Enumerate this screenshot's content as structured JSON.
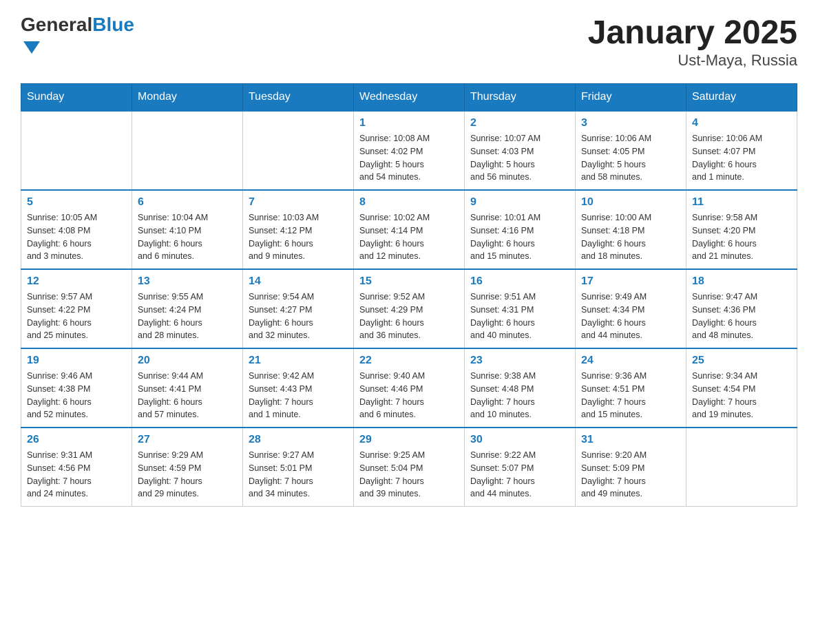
{
  "logo": {
    "text_general": "General",
    "text_blue": "Blue"
  },
  "title": "January 2025",
  "location": "Ust-Maya, Russia",
  "days_of_week": [
    "Sunday",
    "Monday",
    "Tuesday",
    "Wednesday",
    "Thursday",
    "Friday",
    "Saturday"
  ],
  "weeks": [
    [
      {
        "day": "",
        "info": ""
      },
      {
        "day": "",
        "info": ""
      },
      {
        "day": "",
        "info": ""
      },
      {
        "day": "1",
        "info": "Sunrise: 10:08 AM\nSunset: 4:02 PM\nDaylight: 5 hours\nand 54 minutes."
      },
      {
        "day": "2",
        "info": "Sunrise: 10:07 AM\nSunset: 4:03 PM\nDaylight: 5 hours\nand 56 minutes."
      },
      {
        "day": "3",
        "info": "Sunrise: 10:06 AM\nSunset: 4:05 PM\nDaylight: 5 hours\nand 58 minutes."
      },
      {
        "day": "4",
        "info": "Sunrise: 10:06 AM\nSunset: 4:07 PM\nDaylight: 6 hours\nand 1 minute."
      }
    ],
    [
      {
        "day": "5",
        "info": "Sunrise: 10:05 AM\nSunset: 4:08 PM\nDaylight: 6 hours\nand 3 minutes."
      },
      {
        "day": "6",
        "info": "Sunrise: 10:04 AM\nSunset: 4:10 PM\nDaylight: 6 hours\nand 6 minutes."
      },
      {
        "day": "7",
        "info": "Sunrise: 10:03 AM\nSunset: 4:12 PM\nDaylight: 6 hours\nand 9 minutes."
      },
      {
        "day": "8",
        "info": "Sunrise: 10:02 AM\nSunset: 4:14 PM\nDaylight: 6 hours\nand 12 minutes."
      },
      {
        "day": "9",
        "info": "Sunrise: 10:01 AM\nSunset: 4:16 PM\nDaylight: 6 hours\nand 15 minutes."
      },
      {
        "day": "10",
        "info": "Sunrise: 10:00 AM\nSunset: 4:18 PM\nDaylight: 6 hours\nand 18 minutes."
      },
      {
        "day": "11",
        "info": "Sunrise: 9:58 AM\nSunset: 4:20 PM\nDaylight: 6 hours\nand 21 minutes."
      }
    ],
    [
      {
        "day": "12",
        "info": "Sunrise: 9:57 AM\nSunset: 4:22 PM\nDaylight: 6 hours\nand 25 minutes."
      },
      {
        "day": "13",
        "info": "Sunrise: 9:55 AM\nSunset: 4:24 PM\nDaylight: 6 hours\nand 28 minutes."
      },
      {
        "day": "14",
        "info": "Sunrise: 9:54 AM\nSunset: 4:27 PM\nDaylight: 6 hours\nand 32 minutes."
      },
      {
        "day": "15",
        "info": "Sunrise: 9:52 AM\nSunset: 4:29 PM\nDaylight: 6 hours\nand 36 minutes."
      },
      {
        "day": "16",
        "info": "Sunrise: 9:51 AM\nSunset: 4:31 PM\nDaylight: 6 hours\nand 40 minutes."
      },
      {
        "day": "17",
        "info": "Sunrise: 9:49 AM\nSunset: 4:34 PM\nDaylight: 6 hours\nand 44 minutes."
      },
      {
        "day": "18",
        "info": "Sunrise: 9:47 AM\nSunset: 4:36 PM\nDaylight: 6 hours\nand 48 minutes."
      }
    ],
    [
      {
        "day": "19",
        "info": "Sunrise: 9:46 AM\nSunset: 4:38 PM\nDaylight: 6 hours\nand 52 minutes."
      },
      {
        "day": "20",
        "info": "Sunrise: 9:44 AM\nSunset: 4:41 PM\nDaylight: 6 hours\nand 57 minutes."
      },
      {
        "day": "21",
        "info": "Sunrise: 9:42 AM\nSunset: 4:43 PM\nDaylight: 7 hours\nand 1 minute."
      },
      {
        "day": "22",
        "info": "Sunrise: 9:40 AM\nSunset: 4:46 PM\nDaylight: 7 hours\nand 6 minutes."
      },
      {
        "day": "23",
        "info": "Sunrise: 9:38 AM\nSunset: 4:48 PM\nDaylight: 7 hours\nand 10 minutes."
      },
      {
        "day": "24",
        "info": "Sunrise: 9:36 AM\nSunset: 4:51 PM\nDaylight: 7 hours\nand 15 minutes."
      },
      {
        "day": "25",
        "info": "Sunrise: 9:34 AM\nSunset: 4:54 PM\nDaylight: 7 hours\nand 19 minutes."
      }
    ],
    [
      {
        "day": "26",
        "info": "Sunrise: 9:31 AM\nSunset: 4:56 PM\nDaylight: 7 hours\nand 24 minutes."
      },
      {
        "day": "27",
        "info": "Sunrise: 9:29 AM\nSunset: 4:59 PM\nDaylight: 7 hours\nand 29 minutes."
      },
      {
        "day": "28",
        "info": "Sunrise: 9:27 AM\nSunset: 5:01 PM\nDaylight: 7 hours\nand 34 minutes."
      },
      {
        "day": "29",
        "info": "Sunrise: 9:25 AM\nSunset: 5:04 PM\nDaylight: 7 hours\nand 39 minutes."
      },
      {
        "day": "30",
        "info": "Sunrise: 9:22 AM\nSunset: 5:07 PM\nDaylight: 7 hours\nand 44 minutes."
      },
      {
        "day": "31",
        "info": "Sunrise: 9:20 AM\nSunset: 5:09 PM\nDaylight: 7 hours\nand 49 minutes."
      },
      {
        "day": "",
        "info": ""
      }
    ]
  ]
}
